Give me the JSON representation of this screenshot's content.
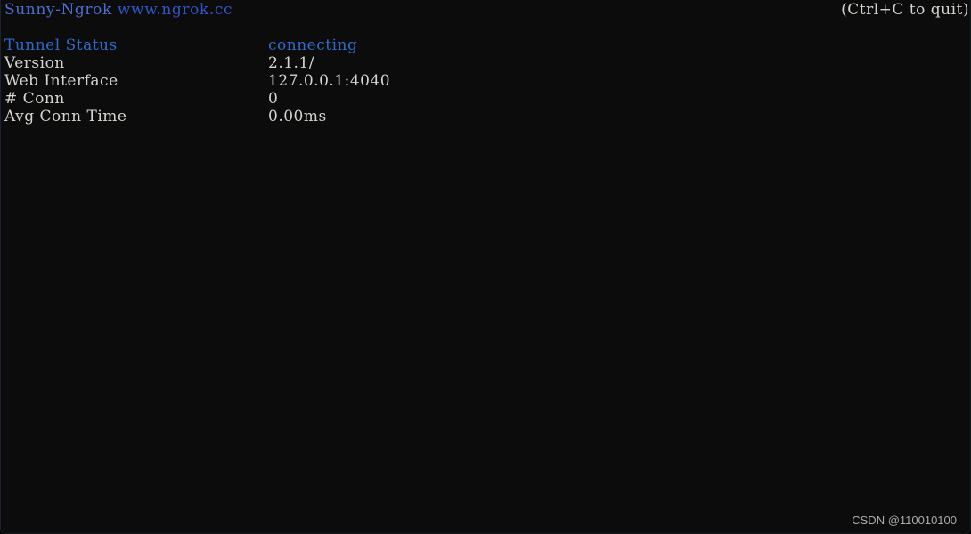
{
  "terminal": {
    "background_color": "#0c0c0d",
    "text_color": "#d8d5cf",
    "accent_color": "#2f6cc9"
  },
  "header": {
    "brand_name": "Sunny-Ngrok",
    "brand_separator": " ",
    "brand_url": "www.ngrok.cc",
    "quit_hint": "(Ctrl+C to quit)"
  },
  "status": {
    "rows": [
      {
        "label": "Tunnel Status",
        "value": "connecting",
        "accent": true
      },
      {
        "label": "Version",
        "value": "2.1.1/",
        "accent": false
      },
      {
        "label": "Web Interface",
        "value": "127.0.0.1:4040",
        "accent": false
      },
      {
        "label": "# Conn",
        "value": "0",
        "accent": false
      },
      {
        "label": "Avg Conn Time",
        "value": "0.00ms",
        "accent": false
      }
    ]
  },
  "watermark": {
    "text": "CSDN @110010100"
  }
}
